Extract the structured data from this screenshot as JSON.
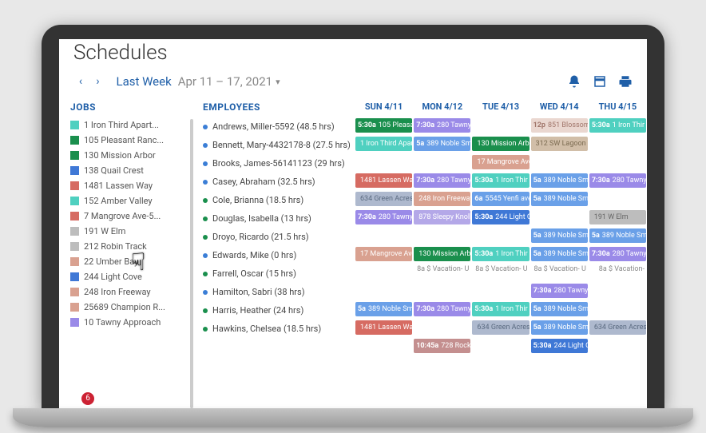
{
  "page": {
    "title": "Schedules"
  },
  "toolbar": {
    "range_label": "Last Week",
    "range_dates": "Apr 11 – 17, 2021"
  },
  "headers": {
    "jobs": "JOBS",
    "employees": "EMPLOYEES",
    "days": [
      "SUN 4/11",
      "MON 4/12",
      "TUE 4/13",
      "WED 4/14",
      "THU 4/15"
    ]
  },
  "jobs": [
    {
      "color": "#4fd0c0",
      "name": "1 Iron Third Apart..."
    },
    {
      "color": "#1a8f4d",
      "name": "105 Pleasant Ranc..."
    },
    {
      "color": "#1a8f4d",
      "name": "130 Mission Arbor"
    },
    {
      "color": "#3f78d6",
      "name": "138 Quail Crest"
    },
    {
      "color": "#d66b62",
      "name": "1481 Lassen Way"
    },
    {
      "color": "#4fd0c0",
      "name": "152 Amber Valley"
    },
    {
      "color": "#d66b62",
      "name": "7 Mangrove Ave-5..."
    },
    {
      "color": "#bdbdbd",
      "name": "191 W Elm"
    },
    {
      "color": "#bdbdbd",
      "name": "212 Robin Track"
    },
    {
      "color": "#d9a190",
      "name": "22 Umber Bay"
    },
    {
      "color": "#3f78d6",
      "name": "244 Light Cove"
    },
    {
      "color": "#d9a190",
      "name": "248 Iron Freeway"
    },
    {
      "color": "#d9a190",
      "name": "25689 Champion R..."
    },
    {
      "color": "#9a8ae8",
      "name": "10 Tawny Approach"
    }
  ],
  "employees": [
    {
      "dot": "#3b7ed6",
      "name": "Andrews, Miller-5592 (48.5 hrs)"
    },
    {
      "dot": "#3b7ed6",
      "name": "Bennett, Mary-4432178-8 (27.5 hrs)"
    },
    {
      "dot": "#3b7ed6",
      "name": "Brooks, James-56141123 (29 hrs)"
    },
    {
      "dot": "#3b7ed6",
      "name": "Casey, Abraham (32.5 hrs)"
    },
    {
      "dot": "#1a8f4d",
      "name": "Cole, Brianna (18.5 hrs)"
    },
    {
      "dot": "#1a8f4d",
      "name": "Douglas, Isabella (13 hrs)"
    },
    {
      "dot": "#1a8f4d",
      "name": "Droyo, Ricardo (21.5 hrs)"
    },
    {
      "dot": "#3b7ed6",
      "name": "Edwards, Mike (0 hrs)"
    },
    {
      "dot": "#1a8f4d",
      "name": "Farrell, Oscar (15 hrs)"
    },
    {
      "dot": "#3b7ed6",
      "name": "Hamilton, Sabri (38 hrs)"
    },
    {
      "dot": "#1a8f4d",
      "name": "Harris, Heather (24 hrs)"
    },
    {
      "dot": "#1a8f4d",
      "name": "Hawkins, Chelsea (18.5 hrs)"
    }
  ],
  "schedule": [
    [
      {
        "color": "#1a8f4d",
        "time": "5:30a",
        "label": "105 Pleasan"
      },
      {
        "color": "#9a8ae8",
        "time": "7:30a",
        "label": "280 Tawny"
      },
      null,
      {
        "color": "#ead7d0",
        "time": "12p",
        "label": "851 Blossom",
        "text": "#a0756a"
      },
      {
        "color": "#4fd0c0",
        "time": "5:30a",
        "label": "1 Iron Thir"
      }
    ],
    [
      {
        "color": "#4fd0c0",
        "time": "",
        "label": "1 Iron Third Apar"
      },
      {
        "color": "#6aa0e8",
        "time": "5a",
        "label": "389 Noble Sm"
      },
      {
        "color": "#1a8f4d",
        "time": "",
        "label": "130 Mission Arbo"
      },
      {
        "color": "#d1bea8",
        "time": "",
        "label": "312 SW Lagoon C",
        "text": "#7a6a50"
      },
      null
    ],
    [
      null,
      null,
      {
        "color": "#d9a190",
        "time": "",
        "label": "17 Mangrove Ave"
      },
      null,
      null
    ],
    [
      {
        "color": "#d66b62",
        "time": "",
        "label": "1481 Lassen Way"
      },
      {
        "color": "#9a8ae8",
        "time": "7:30a",
        "label": "280 Tawny"
      },
      {
        "color": "#4fd0c0",
        "time": "5:30a",
        "label": "1 Iron Thir"
      },
      {
        "color": "#6aa0e8",
        "time": "5a",
        "label": "389 Noble Sm"
      },
      {
        "color": "#9a8ae8",
        "time": "7:30a",
        "label": "280 Tawny"
      }
    ],
    [
      {
        "color": "#aeb9ce",
        "time": "",
        "label": "634 Green Acres",
        "text": "#5a6a80"
      },
      {
        "color": "#d9a190",
        "time": "",
        "label": "248 Iron Freeway"
      },
      {
        "color": "#6aa0e8",
        "time": "6a",
        "label": "5545 Yenfi ave"
      },
      {
        "color": "#6aa0e8",
        "time": "5a",
        "label": "389 Noble Sm"
      },
      null
    ],
    [
      {
        "color": "#9a8ae8",
        "time": "7:30a",
        "label": "280 Tawny"
      },
      {
        "color": "#b4a8e8",
        "time": "",
        "label": "878 Sleepy Knoll"
      },
      {
        "color": "#3f78d6",
        "time": "5:30a",
        "label": "244 Light C"
      },
      null,
      {
        "color": "#bdbdbd",
        "time": "",
        "label": "191 W Elm",
        "text": "#666"
      }
    ],
    [
      null,
      null,
      null,
      {
        "color": "#6aa0e8",
        "time": "5a",
        "label": "389 Noble Sm"
      },
      {
        "color": "#6aa0e8",
        "time": "5a",
        "label": "389 Noble Sm"
      }
    ],
    [
      {
        "color": "#d9a190",
        "time": "",
        "label": "17 Mangrove Ave"
      },
      {
        "color": "#1a8f4d",
        "time": "",
        "label": "130 Mission Arbo"
      },
      {
        "color": "#4fd0c0",
        "time": "5:30a",
        "label": "1 Iron Thir"
      },
      {
        "color": "#6aa0e8",
        "time": "5a",
        "label": "389 Noble Sm"
      },
      {
        "color": "#9a8ae8",
        "time": "7:30a",
        "label": "280 Tawny"
      }
    ],
    [
      null,
      {
        "text": "#888",
        "plain": "8a  $ Vacation- U"
      },
      {
        "text": "#888",
        "plain": "8a  $ Vacation- U"
      },
      {
        "text": "#888",
        "plain": "8a  $ Vacation- U"
      },
      {
        "text": "#888",
        "plain": "8a  $ Vacation-"
      }
    ],
    [
      null,
      null,
      null,
      {
        "color": "#9a8ae8",
        "time": "7:30a",
        "label": "280 Tawny"
      },
      null
    ],
    [
      {
        "color": "#6aa0e8",
        "time": "5a",
        "label": "389 Noble Sm"
      },
      {
        "color": "#9a8ae8",
        "time": "7:30a",
        "label": "280 Tawny"
      },
      {
        "color": "#4fd0c0",
        "time": "5:30a",
        "label": "1 Iron Thir"
      },
      {
        "color": "#6aa0e8",
        "time": "5a",
        "label": "389 Noble Sm"
      },
      null
    ],
    [
      {
        "color": "#d66b62",
        "time": "",
        "label": "1481 Lassen Way"
      },
      null,
      {
        "color": "#aeb9ce",
        "time": "",
        "label": "634 Green Acres",
        "text": "#5a6a80"
      },
      {
        "color": "#6aa0e8",
        "time": "5a",
        "label": "389 Noble Sm"
      },
      {
        "color": "#aeb9ce",
        "time": "",
        "label": "634 Green Acres",
        "text": "#5a6a80"
      }
    ],
    [
      null,
      {
        "color": "#c48f8f",
        "time": "10:45a",
        "label": "728 Rocky"
      },
      null,
      {
        "color": "#3f78d6",
        "time": "5:30a",
        "label": "244 Light C"
      },
      null
    ]
  ],
  "badge_count": "6"
}
